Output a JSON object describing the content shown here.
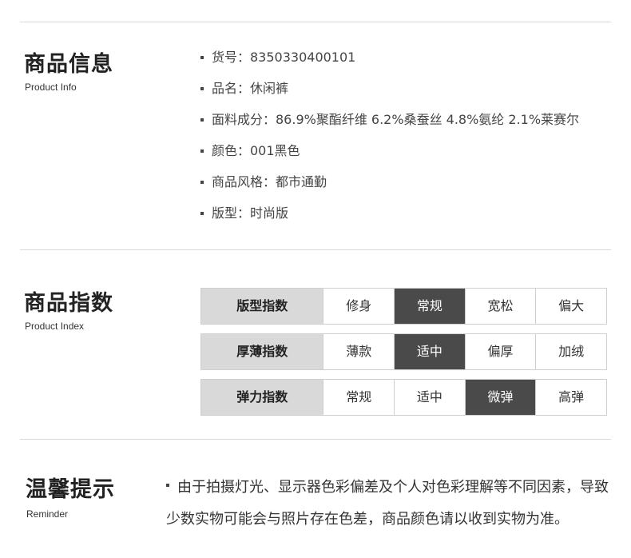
{
  "product_info": {
    "title": "商品信息",
    "subtitle": "Product Info",
    "items": [
      "货号：8350330400101",
      "品名：休闲裤",
      "面料成分：86.9%聚酯纤维 6.2%桑蚕丝 4.8%氨纶 2.1%莱赛尔",
      "颜色：001黑色",
      "商品风格：都市通勤",
      "版型：时尚版"
    ]
  },
  "product_index": {
    "title": "商品指数",
    "subtitle": "Product Index",
    "rows": [
      {
        "label": "版型指数",
        "options": [
          "修身",
          "常规",
          "宽松",
          "偏大"
        ],
        "selected": 1
      },
      {
        "label": "厚薄指数",
        "options": [
          "薄款",
          "适中",
          "偏厚",
          "加绒"
        ],
        "selected": 1
      },
      {
        "label": "弹力指数",
        "options": [
          "常规",
          "适中",
          "微弹",
          "高弹"
        ],
        "selected": 2
      }
    ]
  },
  "reminder": {
    "title": "温馨提示",
    "subtitle": "Reminder",
    "text": "由于拍摄灯光、显示器色彩偏差及个人对色彩理解等不同因素，导致少数实物可能会与照片存在色差，商品颜色请以收到实物为准。"
  },
  "colors": {
    "selected_bg": "#4a4a4a",
    "header_bg": "#d9d9d9",
    "divider": "#d8d8d8"
  }
}
